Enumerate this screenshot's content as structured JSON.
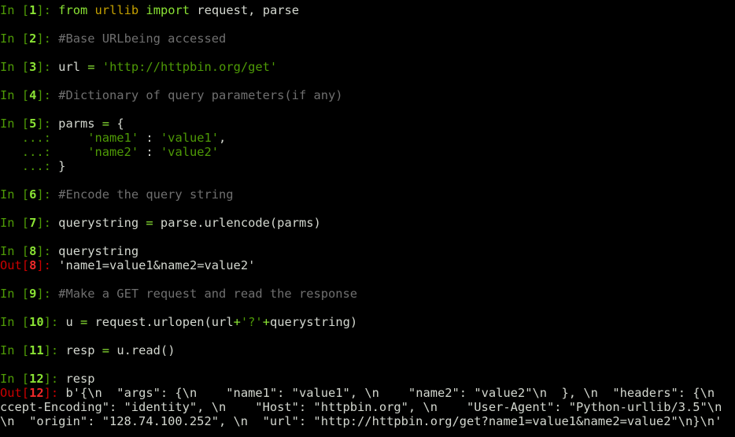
{
  "terminal": {
    "lines": [
      [
        [
          "in",
          "In ["
        ],
        [
          "num",
          "1"
        ],
        [
          "in",
          "]: "
        ],
        [
          "kw",
          "from"
        ],
        [
          "text",
          " "
        ],
        [
          "mod",
          "urllib"
        ],
        [
          "text",
          " "
        ],
        [
          "kw",
          "import"
        ],
        [
          "text",
          " request, parse"
        ]
      ],
      [],
      [
        [
          "in",
          "In ["
        ],
        [
          "num",
          "2"
        ],
        [
          "in",
          "]: "
        ],
        [
          "comment",
          "#Base URLbeing accessed"
        ]
      ],
      [],
      [
        [
          "in",
          "In ["
        ],
        [
          "num",
          "3"
        ],
        [
          "in",
          "]: "
        ],
        [
          "text",
          "url "
        ],
        [
          "op",
          "="
        ],
        [
          "text",
          " "
        ],
        [
          "str",
          "'http://httpbin.org/get'"
        ]
      ],
      [],
      [
        [
          "in",
          "In ["
        ],
        [
          "num",
          "4"
        ],
        [
          "in",
          "]: "
        ],
        [
          "comment",
          "#Dictionary of query parameters(if any)"
        ]
      ],
      [],
      [
        [
          "in",
          "In ["
        ],
        [
          "num",
          "5"
        ],
        [
          "in",
          "]: "
        ],
        [
          "text",
          "parms "
        ],
        [
          "op",
          "="
        ],
        [
          "text",
          " {"
        ]
      ],
      [
        [
          "cont",
          "   ...: "
        ],
        [
          "text",
          "    "
        ],
        [
          "str",
          "'name1'"
        ],
        [
          "text",
          " : "
        ],
        [
          "str",
          "'value1'"
        ],
        [
          "text",
          ","
        ]
      ],
      [
        [
          "cont",
          "   ...: "
        ],
        [
          "text",
          "    "
        ],
        [
          "str",
          "'name2'"
        ],
        [
          "text",
          " : "
        ],
        [
          "str",
          "'value2'"
        ]
      ],
      [
        [
          "cont",
          "   ...: "
        ],
        [
          "text",
          "}"
        ]
      ],
      [],
      [
        [
          "in",
          "In ["
        ],
        [
          "num",
          "6"
        ],
        [
          "in",
          "]: "
        ],
        [
          "comment",
          "#Encode the query string"
        ]
      ],
      [],
      [
        [
          "in",
          "In ["
        ],
        [
          "num",
          "7"
        ],
        [
          "in",
          "]: "
        ],
        [
          "text",
          "querystring "
        ],
        [
          "op",
          "="
        ],
        [
          "text",
          " parse.urlencode(parms)"
        ]
      ],
      [],
      [
        [
          "in",
          "In ["
        ],
        [
          "num",
          "8"
        ],
        [
          "in",
          "]: "
        ],
        [
          "text",
          "querystring"
        ]
      ],
      [
        [
          "out",
          "Out["
        ],
        [
          "outnum",
          "8"
        ],
        [
          "out",
          "]: "
        ],
        [
          "text",
          "'name1=value1&name2=value2'"
        ]
      ],
      [],
      [
        [
          "in",
          "In ["
        ],
        [
          "num",
          "9"
        ],
        [
          "in",
          "]: "
        ],
        [
          "comment",
          "#Make a GET request and read the response"
        ]
      ],
      [],
      [
        [
          "in",
          "In ["
        ],
        [
          "num",
          "10"
        ],
        [
          "in",
          "]: "
        ],
        [
          "text",
          "u "
        ],
        [
          "op",
          "="
        ],
        [
          "text",
          " request.urlopen(url"
        ],
        [
          "op",
          "+"
        ],
        [
          "str",
          "'?'"
        ],
        [
          "op",
          "+"
        ],
        [
          "text",
          "querystring)"
        ]
      ],
      [],
      [
        [
          "in",
          "In ["
        ],
        [
          "num",
          "11"
        ],
        [
          "in",
          "]: "
        ],
        [
          "text",
          "resp "
        ],
        [
          "op",
          "="
        ],
        [
          "text",
          " u.read()"
        ]
      ],
      [],
      [
        [
          "in",
          "In ["
        ],
        [
          "num",
          "12"
        ],
        [
          "in",
          "]: "
        ],
        [
          "text",
          "resp"
        ]
      ],
      [
        [
          "out",
          "Out["
        ],
        [
          "outnum",
          "12"
        ],
        [
          "out",
          "]: "
        ],
        [
          "text",
          "b'{\\n  \"args\": {\\n    \"name1\": \"value1\", \\n    \"name2\": \"value2\"\\n  }, \\n  \"headers\": {\\n    \"Ac"
        ]
      ],
      [
        [
          "text",
          "ccept-Encoding\": \"identity\", \\n    \"Host\": \"httpbin.org\", \\n    \"User-Agent\": \"Python-urllib/3.5\"\\n  }, "
        ]
      ],
      [
        [
          "text",
          "\\n  \"origin\": \"128.74.100.252\", \\n  \"url\": \"http://httpbin.org/get?name1=value1&name2=value2\"\\n}\\n'"
        ]
      ]
    ]
  }
}
